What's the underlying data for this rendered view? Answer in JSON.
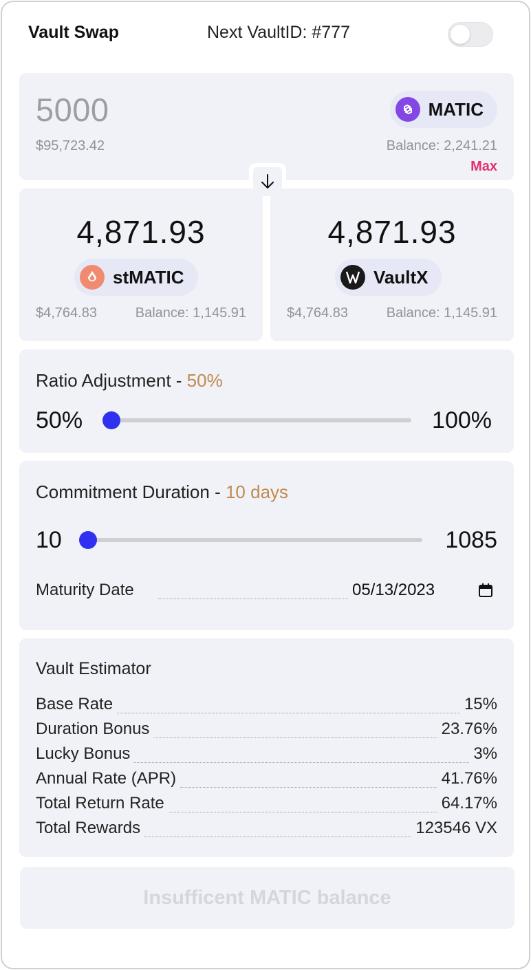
{
  "header": {
    "title": "Vault Swap",
    "next_vault_id": "Next VaultID: #777"
  },
  "swap_input": {
    "amount": "5000",
    "usd_value": "$95,723.42",
    "token": "MATIC",
    "token_icon": "polygon-icon",
    "balance": "Balance: 2,241.21",
    "max_label": "Max"
  },
  "outputs": [
    {
      "amount": "4,871.93",
      "token": "stMATIC",
      "token_icon": "stmatic-icon",
      "usd_value": "$4,764.83",
      "balance": "Balance: 1,145.91"
    },
    {
      "amount": "4,871.93",
      "token": "VaultX",
      "token_icon": "vaultx-icon",
      "usd_value": "$4,764.83",
      "balance": "Balance: 1,145.91"
    }
  ],
  "ratio": {
    "title": "Ratio Adjustment",
    "separator": " - ",
    "value_label": "50%",
    "min_label": "50%",
    "max_label": "100%",
    "min": 50,
    "max": 100,
    "value": 50
  },
  "duration": {
    "title": "Commitment Duration",
    "separator": " - ",
    "value_label": "10 days",
    "min_label": "10",
    "max_label": "1085",
    "min": 10,
    "max": 1085,
    "value": 10,
    "maturity_label": "Maturity Date",
    "maturity_value": "05/13/2023"
  },
  "estimator": {
    "title": "Vault Estimator",
    "rows": [
      {
        "label": "Base Rate",
        "value": "15%"
      },
      {
        "label": "Duration Bonus",
        "value": "23.76%"
      },
      {
        "label": "Lucky Bonus",
        "value": "3%"
      },
      {
        "label": "Annual Rate (APR)",
        "value": "41.76%"
      },
      {
        "label": "Total Return Rate",
        "value": "64.17%"
      },
      {
        "label": "Total Rewards",
        "value": "123546 VX"
      }
    ]
  },
  "submit": {
    "label": "Insufficent MATIC balance"
  },
  "colors": {
    "accent": "#3030f0",
    "max": "#e0306c",
    "highlight": "#c08a50",
    "matic": "#8247e5",
    "stmatic": "#f08a70"
  }
}
